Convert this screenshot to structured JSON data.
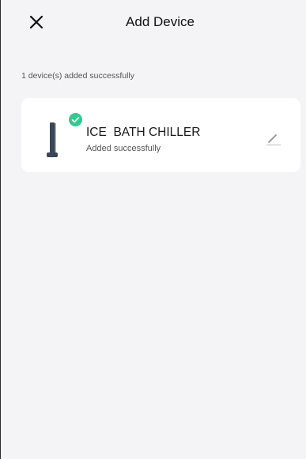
{
  "header": {
    "title": "Add Device",
    "close_icon": "close-icon"
  },
  "summary": {
    "text": "1 device(s) added successfully"
  },
  "devices": [
    {
      "name": "ICE  BATH CHILLER",
      "status": "Added successfully",
      "status_icon": "check-circle-icon",
      "edit_icon": "edit-pencil-icon",
      "image_icon": "device-image-icon"
    }
  ],
  "colors": {
    "background": "#f4f4f6",
    "card": "#ffffff",
    "success": "#2ecc8f"
  }
}
